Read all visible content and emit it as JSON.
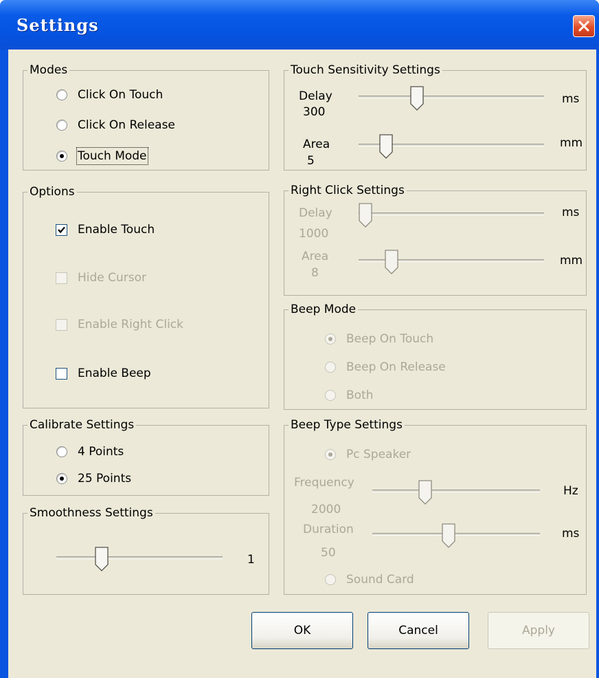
{
  "window": {
    "title": "Settings"
  },
  "modes": {
    "title": "Modes",
    "options": [
      "Click On Touch",
      "Click On Release",
      "Touch Mode"
    ],
    "selected": 2
  },
  "options": {
    "title": "Options",
    "enable_touch": "Enable Touch",
    "hide_cursor": "Hide Cursor",
    "enable_right_click": "Enable Right Click",
    "enable_beep": "Enable Beep",
    "checked": {
      "enable_touch": true,
      "hide_cursor": false,
      "enable_right_click": false,
      "enable_beep": false
    }
  },
  "calibrate": {
    "title": "Calibrate Settings",
    "options": [
      "4 Points",
      "25 Points"
    ],
    "selected": 1
  },
  "smoothness": {
    "title": "Smoothness Settings",
    "value": "1",
    "slider_fraction": 0.25
  },
  "touch_sensitivity": {
    "title": "Touch Sensitivity Settings",
    "delay_label": "Delay",
    "delay_value": "300",
    "delay_unit": "ms",
    "delay_fraction": 0.3,
    "area_label": "Area",
    "area_value": "5",
    "area_unit": "mm",
    "area_fraction": 0.12
  },
  "right_click": {
    "title": "Right Click Settings",
    "delay_label": "Delay",
    "delay_value": "1000",
    "delay_unit": "ms",
    "delay_fraction": 0.0,
    "area_label": "Area",
    "area_value": "8",
    "area_unit": "mm",
    "area_fraction": 0.15
  },
  "beep_mode": {
    "title": "Beep Mode",
    "options": [
      "Beep On Touch",
      "Beep On Release",
      "Both"
    ],
    "selected": 0
  },
  "beep_type": {
    "title": "Beep Type Settings",
    "pc_speaker": "Pc Speaker",
    "frequency_label": "Frequency",
    "frequency_value": "2000",
    "frequency_unit": "Hz",
    "frequency_fraction": 0.3,
    "duration_label": "Duration",
    "duration_value": "50",
    "duration_unit": "ms",
    "duration_fraction": 0.45,
    "sound_card": "Sound Card"
  },
  "buttons": {
    "ok": "OK",
    "cancel": "Cancel",
    "apply": "Apply"
  },
  "colors": {
    "titlebar": "#0553e0",
    "client": "#ece9d8",
    "close": "#e2502a",
    "disabled_text": "#aca899"
  }
}
